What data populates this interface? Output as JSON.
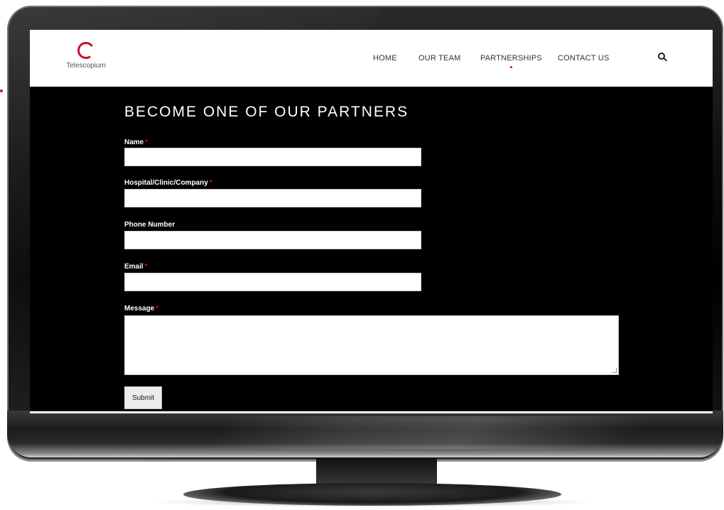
{
  "site": {
    "logo_text": "Telescopium"
  },
  "nav": {
    "items": [
      {
        "label": "HOME"
      },
      {
        "label": "OUR TEAM"
      },
      {
        "label": "PARTNERSHIPS"
      },
      {
        "label": "CONTACT US"
      }
    ],
    "active": "PARTNERSHIPS"
  },
  "form": {
    "title": "BECOME ONE OF OUR PARTNERS",
    "required_marker": "*",
    "fields": [
      {
        "label": "Name",
        "value": "",
        "required": true
      },
      {
        "label": "Hospital/Clinic/Company",
        "value": "",
        "required": true
      },
      {
        "label": "Phone Number",
        "value": "",
        "required": false
      },
      {
        "label": "Email",
        "value": "",
        "required": true
      },
      {
        "label": "Message",
        "value": "",
        "required": true
      }
    ],
    "submit_label": "Submit"
  },
  "colors": {
    "accent": "#c8102e",
    "page_background": "#000000",
    "header_background": "#ffffff"
  },
  "icons": {
    "search": "search-icon",
    "logo": "telescopium-logo-ring-icon"
  }
}
